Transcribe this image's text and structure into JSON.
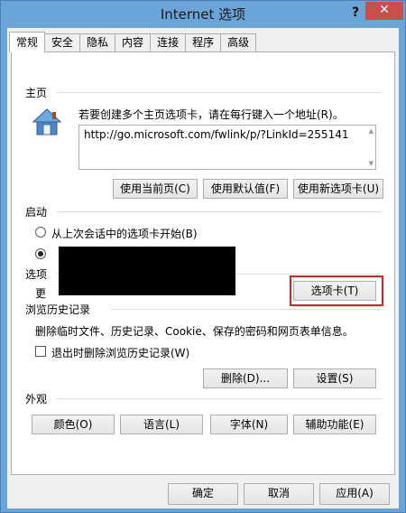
{
  "window": {
    "title": "Internet 选项",
    "help_label": "?",
    "close_label": "✕"
  },
  "tabs": [
    {
      "label": "常规",
      "active": true
    },
    {
      "label": "安全"
    },
    {
      "label": "隐私"
    },
    {
      "label": "内容"
    },
    {
      "label": "连接"
    },
    {
      "label": "程序"
    },
    {
      "label": "高级"
    }
  ],
  "home": {
    "group_label": "主页",
    "description": "若要创建多个主页选项卡，请在每行键入一个地址(R)。",
    "url": "http://go.microsoft.com/fwlink/p/?LinkId=255141",
    "btn_current": "使用当前页(C)",
    "btn_default": "使用默认值(F)",
    "btn_newtab": "使用新选项卡(U)"
  },
  "startup": {
    "group_label": "启动",
    "option_last_session": "从上次会话中的选项卡开始(B)",
    "selected": "second"
  },
  "tabs_section": {
    "group_label": "选项",
    "desc_prefix": "更",
    "tabs_button": "选项卡(T)"
  },
  "history": {
    "group_label": "浏览历史记录",
    "description": "删除临时文件、历史记录、Cookie、保存的密码和网页表单信息。",
    "checkbox_label": "退出时删除浏览历史记录(W)",
    "btn_delete": "删除(D)...",
    "btn_settings": "设置(S)"
  },
  "appearance": {
    "group_label": "外观",
    "btn_colors": "颜色(O)",
    "btn_languages": "语言(L)",
    "btn_fonts": "字体(N)",
    "btn_accessibility": "辅助功能(E)"
  },
  "footer": {
    "ok": "确定",
    "cancel": "取消",
    "apply": "应用(A)"
  },
  "colors": {
    "title_bar": "#6ba5d8",
    "close_button": "#c7504a",
    "highlight_box": "#e02020"
  }
}
